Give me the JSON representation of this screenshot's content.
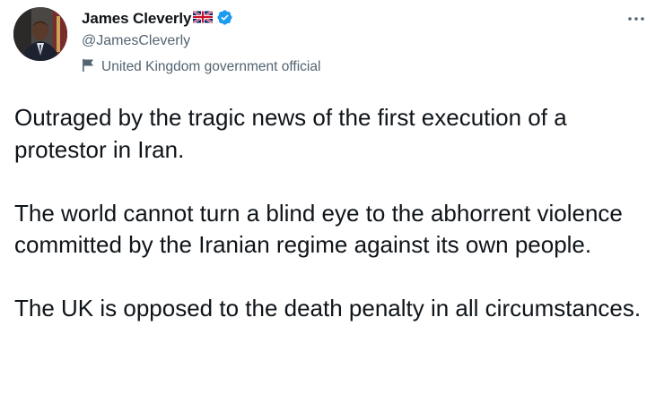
{
  "author": {
    "display_name": "James Cleverly",
    "handle": "@JamesCleverly",
    "flag_icon": "uk-flag-icon",
    "verified_icon": "verified-badge-icon",
    "verified_color": "#1d9bf0",
    "avatar": "avatar"
  },
  "label": {
    "icon": "government-flag-icon",
    "text": "United Kingdom government official"
  },
  "menu": {
    "icon": "more-icon"
  },
  "tweet": {
    "paragraphs": [
      "Outraged by the tragic news of the first execution of a protestor in Iran.",
      "The world cannot turn a blind eye to the abhorrent violence committed by the Iranian regime against its own people.",
      "The UK is opposed to the death penalty in all circumstances."
    ]
  },
  "colors": {
    "text": "#0f1419",
    "secondary": "#536471",
    "background": "#ffffff"
  }
}
